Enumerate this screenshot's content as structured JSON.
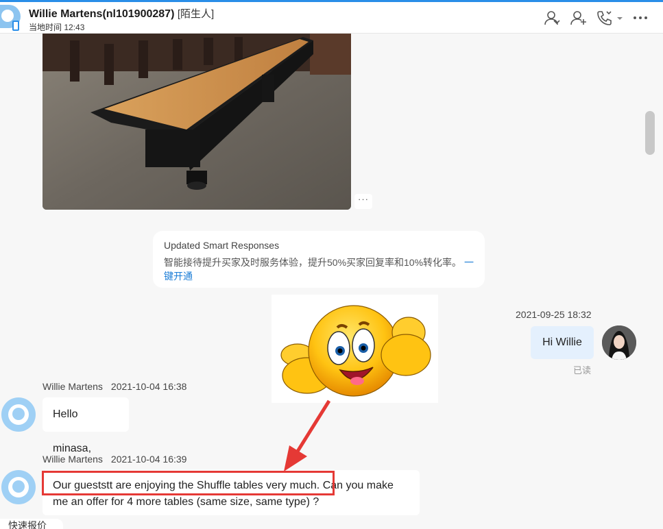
{
  "header": {
    "contact_name": "Willie Martens(nl101900287)",
    "contact_tag": "[陌生人]",
    "local_time": "当地时间 12:43",
    "icons": [
      "contact-card-icon",
      "add-contact-icon",
      "call-icon",
      "more-icon"
    ]
  },
  "notice": {
    "title": "Updated Smart Responses",
    "body": "智能接待提升买家及时服务体验，提升50%买家回复率和10%转化率。",
    "link": "一键开通"
  },
  "photo_message": {
    "more_label": "···"
  },
  "my_message": {
    "timestamp": "2021-09-25 18:32",
    "text": "Hi Willie",
    "read_status": "已读"
  },
  "messages": [
    {
      "sender": "Willie Martens",
      "datetime": "2021-10-04 16:38",
      "text": "Hello minasa,"
    },
    {
      "sender": "Willie Martens",
      "datetime": "2021-10-04 16:39",
      "text": "Our gueststt are enjoying the Shuffle tables very much. Can you make me an offer for 4 more tables (same size, same type) ?"
    }
  ],
  "quick_quote": "快速报价",
  "colors": {
    "accent": "#2a8ee8",
    "highlight": "#e53935",
    "my_bubble": "#e4f0fd",
    "link": "#1a7cd6"
  }
}
